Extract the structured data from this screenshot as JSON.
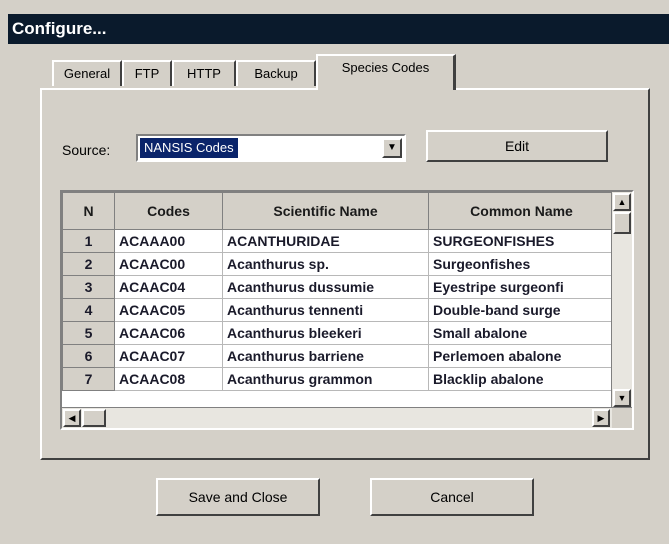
{
  "window": {
    "title": "Configure..."
  },
  "tabs": [
    {
      "label": "General",
      "active": false
    },
    {
      "label": "FTP",
      "active": false
    },
    {
      "label": "HTTP",
      "active": false
    },
    {
      "label": "Backup",
      "active": false
    },
    {
      "label": "Species Codes",
      "active": true
    }
  ],
  "source": {
    "label": "Source:",
    "value": "NANSIS Codes"
  },
  "buttons": {
    "edit": "Edit",
    "save_close": "Save and Close",
    "cancel": "Cancel"
  },
  "table": {
    "headers": [
      "N",
      "Codes",
      "Scientific Name",
      "Common Name"
    ],
    "rows": [
      {
        "n": "1",
        "code": "ACAAA00",
        "scientific": "ACANTHURIDAE",
        "common": "SURGEONFISHES"
      },
      {
        "n": "2",
        "code": "ACAAC00",
        "scientific": "Acanthurus sp.",
        "common": "Surgeonfishes"
      },
      {
        "n": "3",
        "code": "ACAAC04",
        "scientific": "Acanthurus dussumie",
        "common": "Eyestripe surgeonfi"
      },
      {
        "n": "4",
        "code": "ACAAC05",
        "scientific": "Acanthurus tennenti",
        "common": "Double-band surge"
      },
      {
        "n": "5",
        "code": "ACAAC06",
        "scientific": "Acanthurus bleekeri",
        "common": "Small abalone"
      },
      {
        "n": "6",
        "code": "ACAAC07",
        "scientific": "Acanthurus barriene",
        "common": "Perlemoen abalone"
      },
      {
        "n": "7",
        "code": "ACAAC08",
        "scientific": "Acanthurus grammon",
        "common": "Blacklip abalone"
      }
    ]
  },
  "icons": {
    "dropdown": "chevron-down-icon",
    "scroll_up": "arrow-up-icon",
    "scroll_down": "arrow-down-icon",
    "scroll_left": "arrow-left-icon",
    "scroll_right": "arrow-right-icon"
  },
  "colors": {
    "titlebar": "#0a1a2c",
    "face": "#d4d0c8",
    "selection": "#0a246a"
  }
}
